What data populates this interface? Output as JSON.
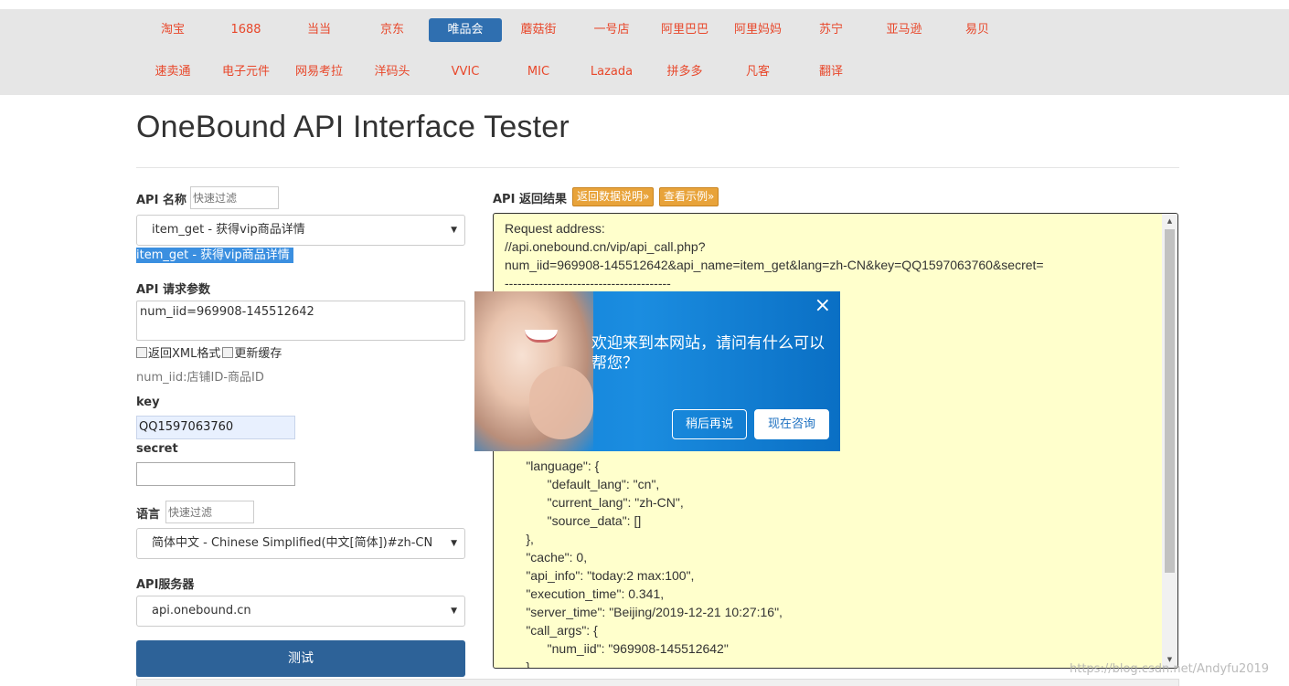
{
  "nav": {
    "row1": [
      "淘宝",
      "1688",
      "当当",
      "京东",
      "唯品会",
      "蘑菇街",
      "一号店",
      "阿里巴巴",
      "阿里妈妈",
      "苏宁",
      "亚马逊",
      "易贝"
    ],
    "row2": [
      "速卖通",
      "电子元件",
      "网易考拉",
      "洋码头",
      "VVIC",
      "MIC",
      "Lazada",
      "拼多多",
      "凡客",
      "翻译"
    ],
    "active": "唯品会"
  },
  "title": "OneBound API Interface Tester",
  "api_name": {
    "label": "API 名称",
    "filter_placeholder": "快速过滤",
    "selected": "item_get - 获得vip商品详情",
    "highlight": "item_get - 获得vip商品详情"
  },
  "params": {
    "label": "API 请求参数",
    "value": "num_iid=969908-145512642",
    "check_xml": "返回XML格式",
    "check_cache": "更新缓存",
    "hint": "num_iid:店铺ID-商品ID"
  },
  "key": {
    "label": "key",
    "value": "QQ1597063760"
  },
  "secret": {
    "label": "secret",
    "value": ""
  },
  "lang": {
    "label": "语言",
    "filter_placeholder": "快速过滤",
    "selected": "简体中文 - Chinese Simplified(中文[简体])#zh-CN"
  },
  "server": {
    "label": "API服务器",
    "selected": "api.onebound.cn"
  },
  "test_button": "测试",
  "result": {
    "label": "API 返回结果",
    "btn_doc": "返回数据说明»",
    "btn_example": "查看示例»",
    "lines": [
      "Request address:",
      "//api.onebound.cn/vip/api_call.php?",
      "num_iid=969908-145512642&api_name=item_get&lang=zh-CN&key=QQ1597063760&secret=",
      "---------------------------------------",
      "",
      "",
      "",
      "",
      "",
      "",
      "",
      "",
      "",
      "      \"language\": {",
      "            \"default_lang\": \"cn\",",
      "            \"current_lang\": \"zh-CN\",",
      "            \"source_data\": []",
      "      },",
      "      \"cache\": 0,",
      "      \"api_info\": \"today:2 max:100\",",
      "      \"execution_time\": 0.341,",
      "      \"server_time\": \"Beijing/2019-12-21 10:27:16\",",
      "      \"call_args\": {",
      "            \"num_iid\": \"969908-145512642\"",
      "      }"
    ]
  },
  "popup": {
    "message": "欢迎来到本网站，请问有什么可以帮您？",
    "later": "稍后再说",
    "now": "现在咨询",
    "close": "×"
  },
  "watermark": "https://blog.csdn.net/Andyfu2019",
  "colors": {
    "nav_text": "#e8472a",
    "nav_active_bg": "#2f6fb0",
    "test_button": "#2d6298",
    "result_bg": "#ffffcc",
    "orange_button": "#e8a33a",
    "popup_blue": "#1b8de0"
  }
}
